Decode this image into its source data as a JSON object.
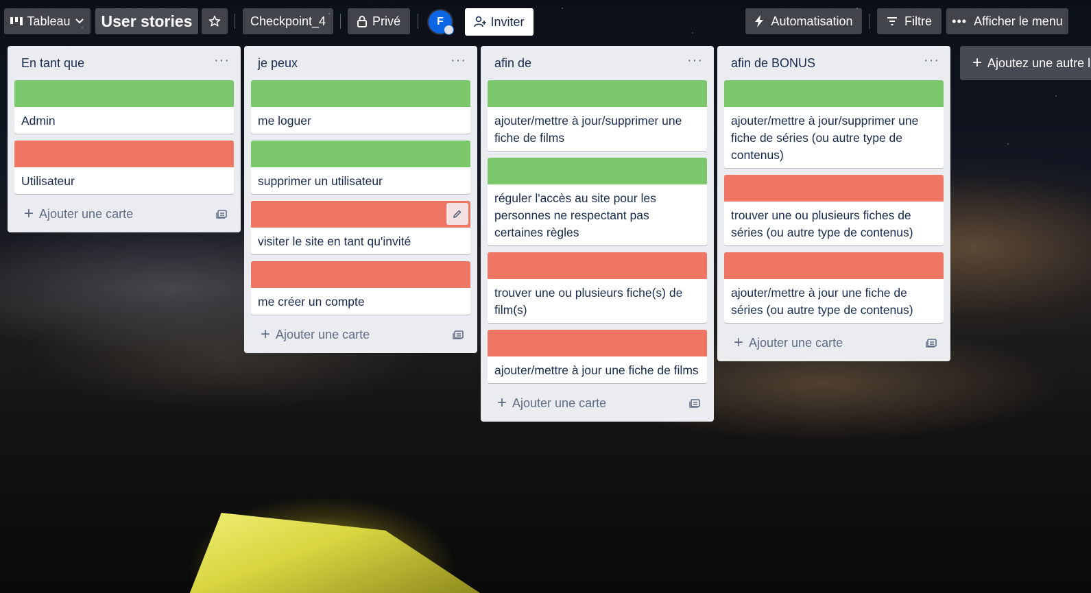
{
  "colors": {
    "green": "#7bc86c",
    "red": "#ef7564"
  },
  "topbar": {
    "view_label": "Tableau",
    "board_title": "User stories",
    "workspace": "Checkpoint_4",
    "visibility": "Privé",
    "member_initial": "F",
    "invite_label": "Inviter",
    "automation_label": "Automatisation",
    "filter_label": "Filtre",
    "menu_label": "Afficher le menu"
  },
  "lists": [
    {
      "title": "En tant que",
      "cards": [
        {
          "cover": "green",
          "text": "Admin"
        },
        {
          "cover": "red",
          "text": "Utilisateur"
        }
      ],
      "add_label": "Ajouter une carte"
    },
    {
      "title": "je peux",
      "cards": [
        {
          "cover": "green",
          "text": "me loguer"
        },
        {
          "cover": "green",
          "text": "supprimer un utilisateur"
        },
        {
          "cover": "red",
          "text": "visiter le site en tant qu'invité"
        },
        {
          "cover": "red",
          "text": "me créer un compte"
        }
      ],
      "add_label": "Ajouter une carte"
    },
    {
      "title": "afin de",
      "cards": [
        {
          "cover": "green",
          "text": "ajouter/mettre à jour/supprimer une fiche de films"
        },
        {
          "cover": "green",
          "text": "réguler l'accès au site pour les personnes ne respectant pas certaines règles"
        },
        {
          "cover": "red",
          "text": "trouver une ou plusieurs fiche(s) de film(s)"
        },
        {
          "cover": "red",
          "text": "ajouter/mettre à jour une fiche de films"
        }
      ],
      "add_label": "Ajouter une carte"
    },
    {
      "title": "afin de BONUS",
      "cards": [
        {
          "cover": "green",
          "text": "ajouter/mettre à jour/supprimer une fiche de séries (ou autre type de contenus)"
        },
        {
          "cover": "red",
          "text": "trouver une ou plusieurs fiches de séries (ou autre type de contenus)"
        },
        {
          "cover": "red",
          "text": "ajouter/mettre à jour une fiche de séries (ou autre type de contenus)"
        }
      ],
      "add_label": "Ajouter une carte"
    }
  ],
  "add_list_label": "Ajoutez une autre liste"
}
